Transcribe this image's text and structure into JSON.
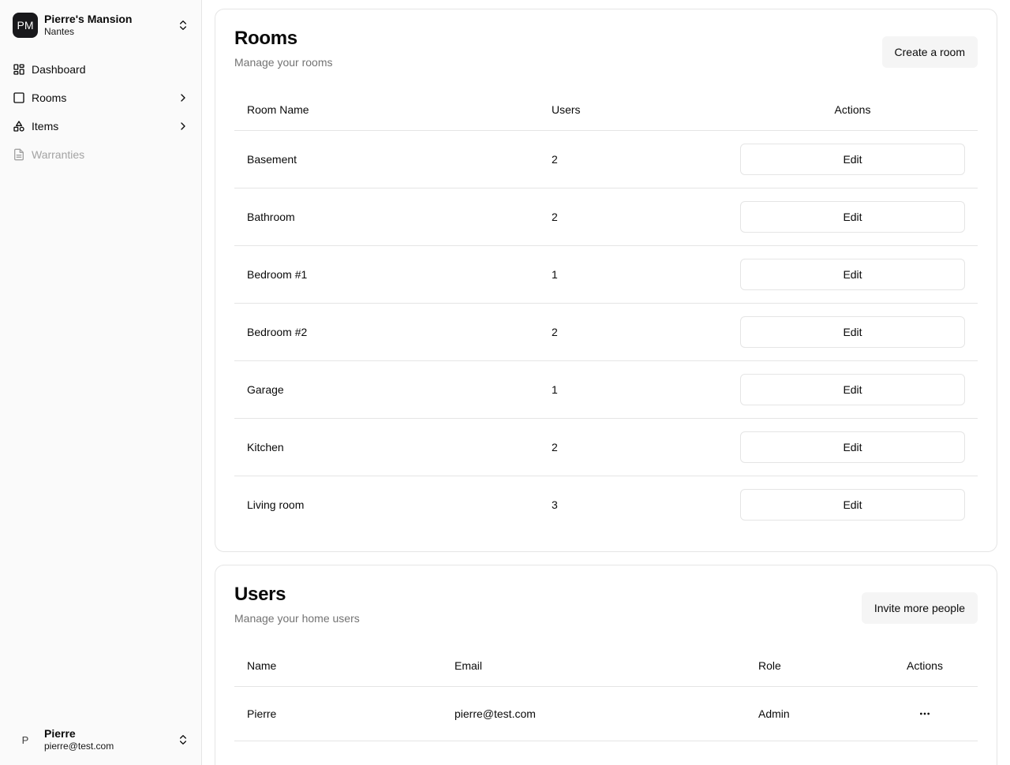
{
  "sidebar": {
    "home": {
      "initials": "PM",
      "name": "Pierre's Mansion",
      "city": "Nantes"
    },
    "nav": [
      {
        "label": "Dashboard",
        "icon": "layout-dashboard-icon"
      },
      {
        "label": "Rooms",
        "icon": "square-icon"
      },
      {
        "label": "Items",
        "icon": "shapes-icon"
      },
      {
        "label": "Warranties",
        "icon": "file-text-icon",
        "disabled": true
      }
    ],
    "user": {
      "initial": "P",
      "name": "Pierre",
      "email": "pierre@test.com"
    }
  },
  "rooms": {
    "title": "Rooms",
    "description": "Manage your rooms",
    "create_label": "Create a room",
    "columns": {
      "name": "Room Name",
      "users": "Users",
      "actions": "Actions"
    },
    "edit_label": "Edit",
    "rows": [
      {
        "name": "Basement",
        "users": "2"
      },
      {
        "name": "Bathroom",
        "users": "2"
      },
      {
        "name": "Bedroom #1",
        "users": "1"
      },
      {
        "name": "Bedroom #2",
        "users": "2"
      },
      {
        "name": "Garage",
        "users": "1"
      },
      {
        "name": "Kitchen",
        "users": "2"
      },
      {
        "name": "Living room",
        "users": "3"
      }
    ]
  },
  "users": {
    "title": "Users",
    "description": "Manage your home users",
    "invite_label": "Invite more people",
    "columns": {
      "name": "Name",
      "email": "Email",
      "role": "Role",
      "actions": "Actions"
    },
    "rows": [
      {
        "name": "Pierre",
        "email": "pierre@test.com",
        "role": "Admin"
      }
    ]
  }
}
